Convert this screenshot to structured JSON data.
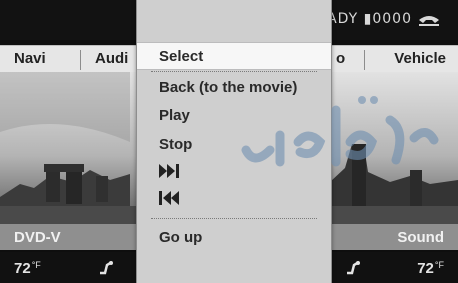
{
  "status_bar": {
    "text": "ADY ▮0000",
    "icon": "phone-icon"
  },
  "main_menu": {
    "navi": "Navi",
    "audio": "Audi",
    "hidden_item_tail": "o",
    "vehicle": "Vehicle"
  },
  "overlay_menu": {
    "items": [
      {
        "label": "Select",
        "selected": true
      },
      {
        "label": "Back (to the movie)"
      },
      {
        "label": "Play"
      },
      {
        "label": "Stop"
      },
      {
        "label": "▶▶|",
        "icon": "skip-forward-icon"
      },
      {
        "label": "|◀◀",
        "icon": "skip-back-icon"
      },
      {
        "label": "Go up"
      }
    ]
  },
  "source_bar": {
    "left": "DVD-V",
    "right": "Sound"
  },
  "climate_bar": {
    "left_temp": "72",
    "left_unit": "°F",
    "right_temp": "72",
    "right_unit": "°F"
  },
  "colors": {
    "menu_bg": "#e6e6e6",
    "overlay_bg": "#cfcfcf",
    "selected_bg": "#f7f7f7",
    "watermark": "#6f8fb0"
  }
}
